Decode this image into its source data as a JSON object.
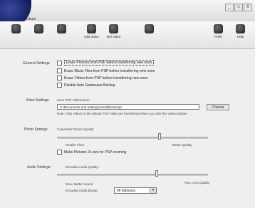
{
  "window": {
    "title": "Rockam",
    "min_label": "_",
    "max_label": "□",
    "close_label": "X"
  },
  "toolbar": {
    "icons": [
      {
        "name": "icon-1",
        "label": ""
      },
      {
        "name": "icon-2",
        "label": ""
      },
      {
        "name": "icon-3",
        "label": ""
      },
      {
        "name": "add-video",
        "label": "Add Video"
      },
      {
        "name": "del-video",
        "label": "Del Video"
      },
      {
        "name": "info",
        "label": ""
      },
      {
        "name": "prefs",
        "label": "Prefs"
      },
      {
        "name": "help",
        "label": "Help"
      }
    ]
  },
  "general": {
    "label": "General Settings:",
    "options": [
      "Erase Pictures from PSP before transferring new ones",
      "Erase Music Files from PSP before transferring new ones",
      "Erase Videos from PSP before transferring new ones",
      "Disable Auto Gamesave Backup"
    ]
  },
  "video": {
    "label": "Video Settings:",
    "save_label": "Save PSP Videos here:",
    "path": "C:\\Documents and Settings\\rsmall\\Desktop\\",
    "choose": "Choose",
    "note": "Note: Only videos in the default PSP folder are transferred when you click the Videos button"
  },
  "photo": {
    "label": "Photo Settings:",
    "quality_label": "Converted Picture Quality:",
    "left": "Smaller Files",
    "right": "Better Quality",
    "resize": "Make Pictures 2x size for PSP zooming"
  },
  "audio": {
    "label": "Audio Settings:",
    "quality_label": "Encoded Audio Quality:",
    "left": "Slow, Better Sound",
    "right": "Fast, Less Quality",
    "bitrate_label": "Encoded Audio Bitrate:",
    "bitrate_value": "96 kbits/sec"
  }
}
